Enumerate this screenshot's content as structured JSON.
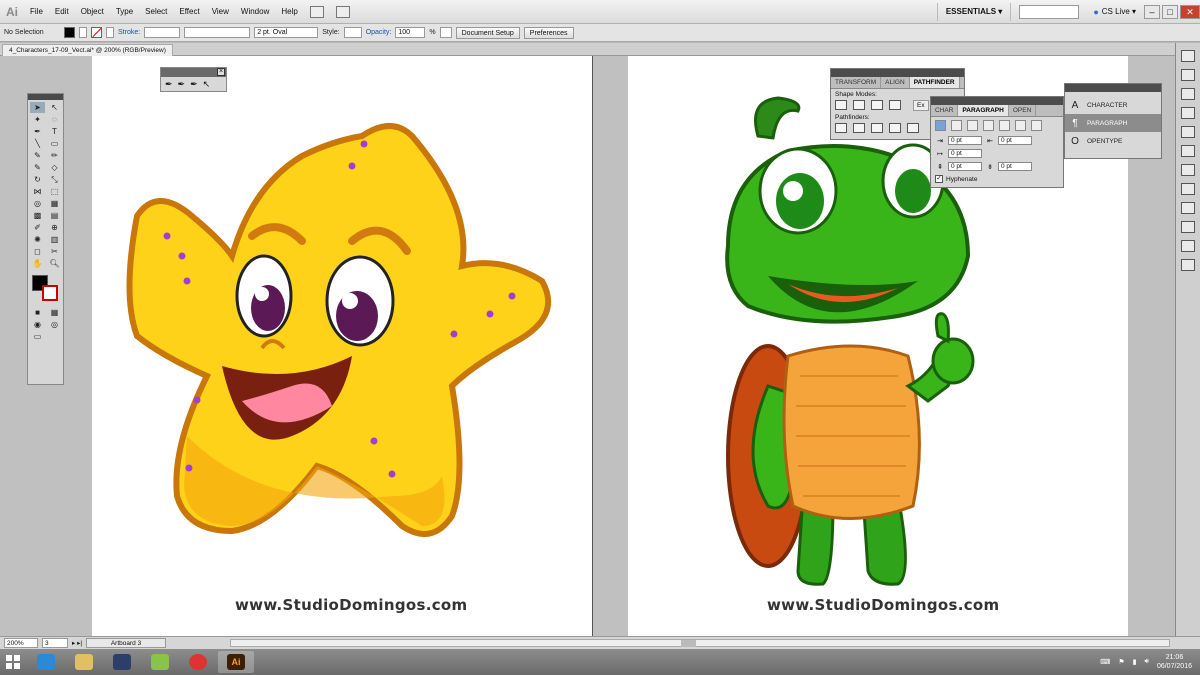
{
  "menubar": {
    "logo": "Ai",
    "items": [
      "File",
      "Edit",
      "Object",
      "Type",
      "Select",
      "Effect",
      "View",
      "Window",
      "Help"
    ],
    "workspace": "ESSENTIALS ▾",
    "cslive": "CS Live ▾"
  },
  "controlbar": {
    "selection": "No Selection",
    "stroke_label": "Stroke:",
    "brush": "2 pt. Oval",
    "style_label": "Style:",
    "opacity_label": "Opacity:",
    "opacity_value": "100",
    "opacity_unit": "%",
    "document_setup": "Document Setup",
    "preferences": "Preferences"
  },
  "document": {
    "tab_title": "4_Characters_17-09_Vect.ai* @ 200% (RGB/Preview)"
  },
  "artboards": {
    "left_watermark": "www.StudioDomingos.com",
    "right_watermark": "www.StudioDomingos.com"
  },
  "pathfinder_panel": {
    "tabs": [
      "TRANSFORM",
      "ALIGN",
      "PATHFINDER"
    ],
    "shape_modes_label": "Shape Modes:",
    "pathfinders_label": "Pathfinders:",
    "expand": "Ex"
  },
  "paragraph_panel": {
    "tabs": [
      "CHAR",
      "PARAGRAPH",
      "OPEN"
    ],
    "fields": [
      "0 pt",
      "0 pt",
      "0 pt",
      "0 pt",
      "0 pt"
    ],
    "hyphenate": "Hyphenate"
  },
  "char_panel": {
    "items": [
      {
        "icon": "A",
        "label": "CHARACTER"
      },
      {
        "icon": "¶",
        "label": "PARAGRAPH"
      },
      {
        "icon": "O",
        "label": "OPENTYPE"
      }
    ]
  },
  "statusbar": {
    "zoom": "200%",
    "artboard_num": "3",
    "artboard_name": "Artboard 3"
  },
  "taskbar": {
    "time": "21:06",
    "date": "06/07/2016"
  },
  "colors": {
    "accent": "#1c50b0",
    "star_fill": "#ffd21a",
    "turtle_fill": "#39b51a"
  }
}
